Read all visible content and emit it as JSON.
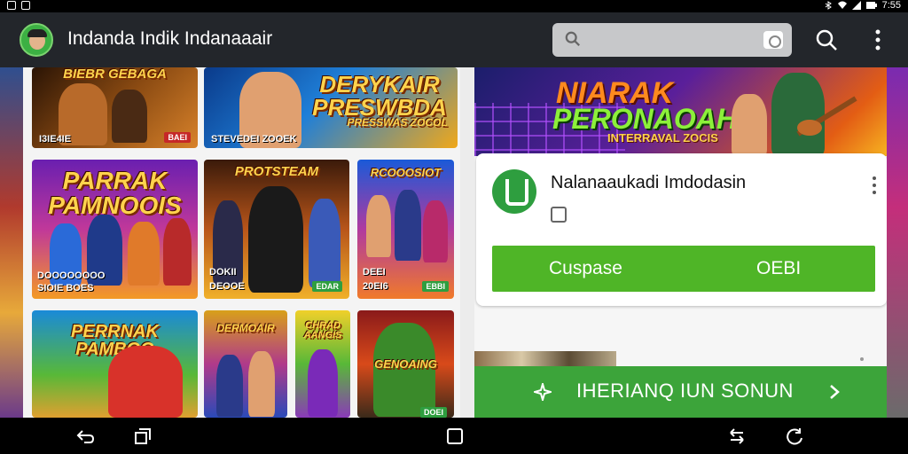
{
  "app": {
    "title": "Indanda Indik Indanaaair"
  },
  "colors": {
    "appbar": "#23262b",
    "accent_green": "#4fb527",
    "cta_green": "#3ca43a",
    "search_bg": "#c7c8ca"
  },
  "status_bar": {
    "time": "7:55"
  },
  "toolbar": {
    "search_icon": "search-icon",
    "more_icon": "more-vert-icon"
  },
  "games": [
    {
      "title": "BIEBR GEBAGA",
      "caption": "I3IE4IE",
      "badge": "BAEI"
    },
    {
      "title": "DERYKAIR PRESWBDA",
      "subtitle": "PRESSWAS ZOCOL",
      "caption": "STEVEDEI ZOOEK"
    },
    {
      "title": "PARRAK PAMNOOIS",
      "caption": "DOOOOOOOO",
      "caption2": "SIOIE BOES"
    },
    {
      "title": "PROTSTEAM",
      "caption": "DOKII",
      "caption2": "DEOOE",
      "badge": "EDAR"
    },
    {
      "title": "RCOOOSIOT",
      "caption": "DEEI",
      "caption2": "20EI6",
      "badge": "EBBI"
    },
    {
      "title": "PERRNAK PAMBOO",
      "caption": ""
    },
    {
      "title": "DERMOAIR",
      "caption": ""
    },
    {
      "title": "CHRAD AANGIS",
      "caption": ""
    },
    {
      "title": "GENOAING",
      "caption": "",
      "badge": "DOEI"
    }
  ],
  "featured": {
    "banner_line1": "NIARAK",
    "banner_line2": "PERONAOAH",
    "banner_line3": "INTERRAVAL ZOCIS",
    "app_name": "Nalanaaukadi Imdodasin",
    "install_left": "Cuspase",
    "install_right": "OEBI"
  },
  "cta": {
    "label": "IHERIANQ IUN SONUN"
  }
}
